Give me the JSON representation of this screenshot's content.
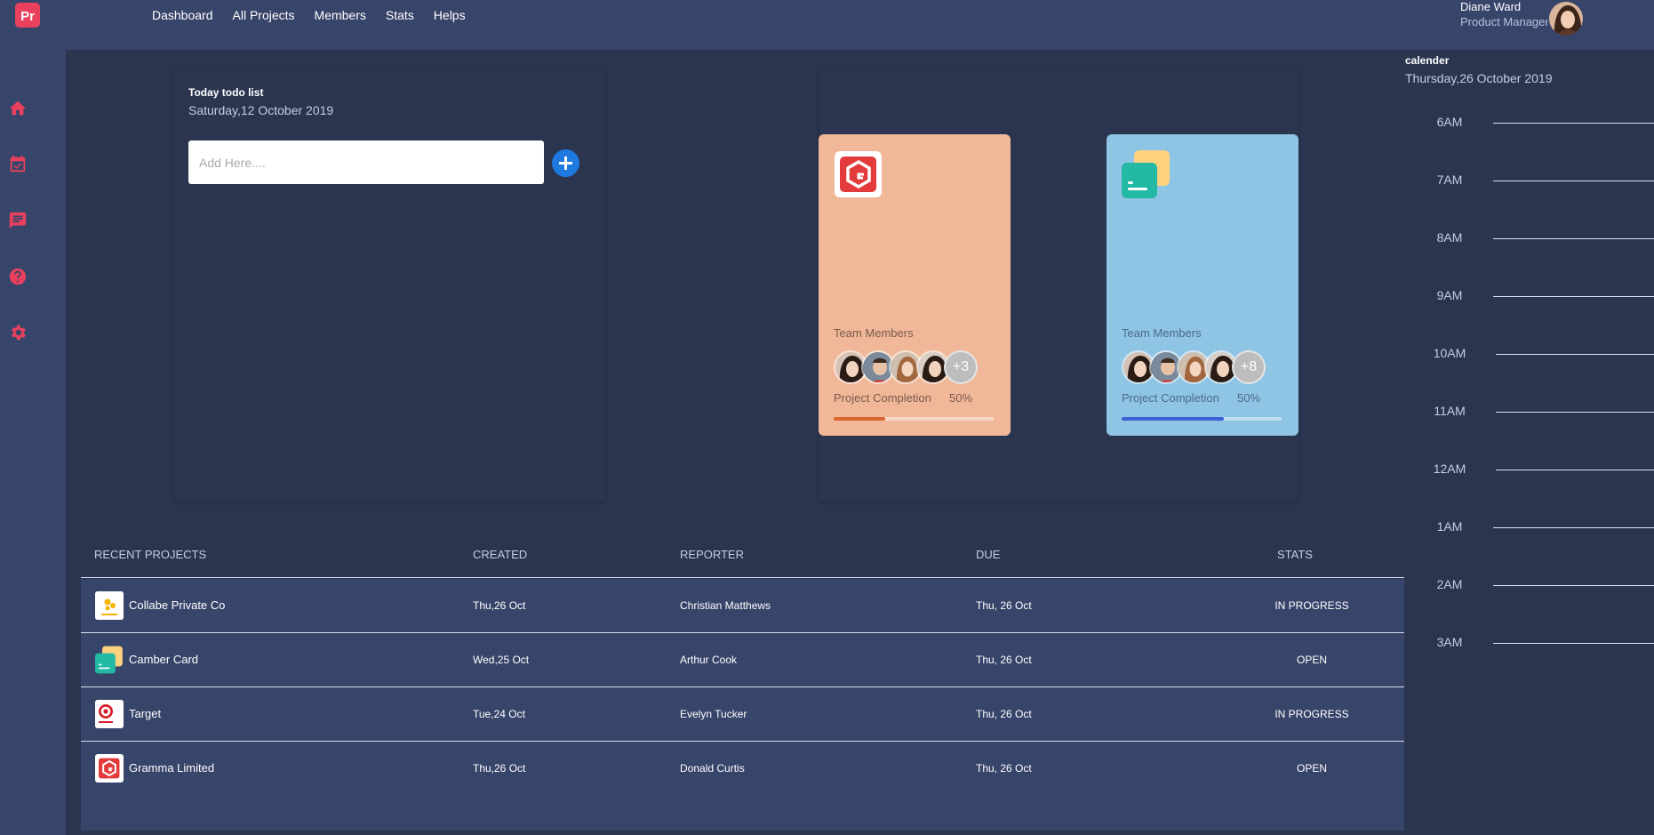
{
  "app": {
    "logo_text": "Pr",
    "brand_color": "#e8405d"
  },
  "nav": [
    "Dashboard",
    "All Projects",
    "Members",
    "Stats",
    "Helps"
  ],
  "user": {
    "name": "Diane Ward",
    "role": "Product Manager"
  },
  "sidebar": {
    "icons": [
      "home-icon",
      "calendar-check-icon",
      "chat-icon",
      "help-icon",
      "settings-icon"
    ]
  },
  "todo": {
    "title": "Today todo list",
    "date": "Saturday,12 October 2019",
    "placeholder": "Add Here....",
    "add_icon": "plus-icon"
  },
  "projects": [
    {
      "logo": "gramma-logo",
      "color": "#f0b899",
      "team_label": "Team Members",
      "more": "+3",
      "completion_label": "Project Completion",
      "completion": "50%",
      "progress": 0.32,
      "progress_color": "#d9652e"
    },
    {
      "logo": "camber-logo",
      "color": "#8ec4e4",
      "team_label": "Team Members",
      "more": "+8",
      "completion_label": "Project Completion",
      "completion": "50%",
      "progress": 0.64,
      "progress_color": "#3f5fd6"
    }
  ],
  "calendar": {
    "title": "calender",
    "date": "Thursday,26 October 2019",
    "hours": [
      "6AM",
      "7AM",
      "8AM",
      "9AM",
      "10AM",
      "11AM",
      "12AM",
      "1AM",
      "2AM",
      "3AM"
    ]
  },
  "table": {
    "headers": [
      "RECENT PROJECTS",
      "CREATED",
      "REPORTER",
      "DUE",
      "STATS"
    ],
    "rows": [
      {
        "name": "Collabe Private Co",
        "created": "Thu,26 Oct",
        "reporter": "Christian Matthews",
        "due": "Thu, 26 Oct",
        "status": "IN PROGRESS"
      },
      {
        "name": "Camber Card",
        "created": "Wed,25 Oct",
        "reporter": "Arthur Cook",
        "due": "Thu, 26 Oct",
        "status": "OPEN"
      },
      {
        "name": "Target",
        "created": "Tue,24 Oct",
        "reporter": "Evelyn Tucker",
        "due": "Thu, 26 Oct",
        "status": "IN PROGRESS"
      },
      {
        "name": "Gramma Limited",
        "created": "Thu,26 Oct",
        "reporter": "Donald Curtis",
        "due": "Thu, 26 Oct",
        "status": "OPEN"
      }
    ]
  }
}
